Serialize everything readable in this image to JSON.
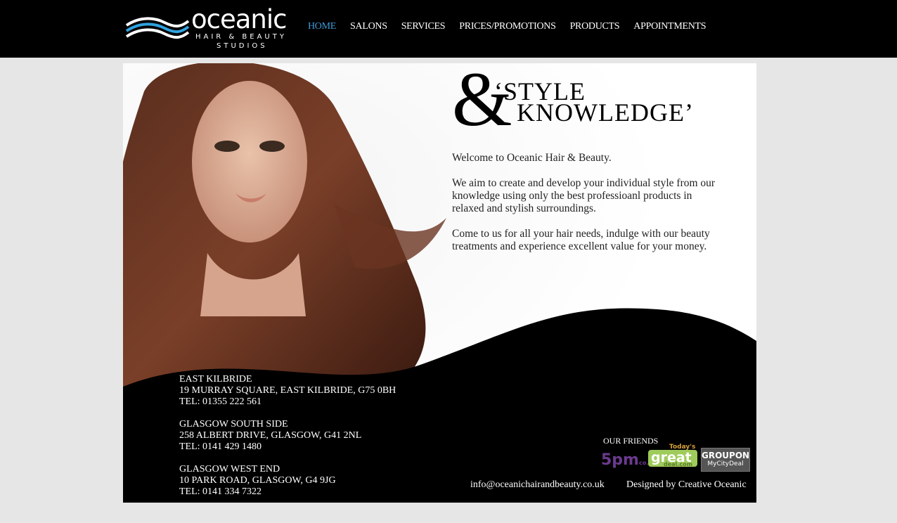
{
  "logo": {
    "word": "oceanic",
    "line1": "HAIR & BEAUTY",
    "line2": "STUDIOS"
  },
  "nav": [
    {
      "label": "HOME",
      "active": true
    },
    {
      "label": "SALONS"
    },
    {
      "label": "SERVICES"
    },
    {
      "label": "PRICES/PROMOTIONS"
    },
    {
      "label": "PRODUCTS"
    },
    {
      "label": "APPOINTMENTS"
    }
  ],
  "headline": {
    "amp": "&",
    "line1": "‘STYLE",
    "line2": "KNOWLEDGE’"
  },
  "copy": [
    "Welcome to Oceanic Hair & Beauty.",
    "We aim to create and develop your individual style from our knowledge using only the best professioanl products in relaxed and stylish surroundings.",
    "Come to us for all your hair needs, indulge with our beauty treatments and experience excellent value for your money."
  ],
  "addresses": [
    {
      "name": "EAST KILBRIDE",
      "street": "19 MURRAY SQUARE, EAST KILBRIDE, G75 0BH",
      "tel": "TEL: 01355 222 561"
    },
    {
      "name": "GLASGOW SOUTH SIDE",
      "street": "258 ALBERT DRIVE, GLASGOW, G41 2NL",
      "tel": "TEL: 0141 429 1480"
    },
    {
      "name": "GLASGOW WEST END",
      "street": "10 PARK ROAD, GLASGOW, G4 9JG",
      "tel": "TEL: 0141 334 7322"
    }
  ],
  "friends": {
    "label": "OUR FRIENDS",
    "partners": {
      "fivepm": "5pm",
      "fivepm_suffix": "co.uk",
      "great": "great",
      "great_top": "Today's",
      "great_bottom": "deal.com",
      "groupon": "GROUPON",
      "groupon_sub": "MyCityDeal"
    }
  },
  "footer": {
    "email": "info@oceanichairandbeauty.co.uk",
    "designed": "Designed by Creative Oceanic"
  },
  "colors": {
    "nav_active": "#3f9ad6",
    "logo_wave_blue": "#2fa3e0",
    "fivepm_purple": "#6b3a8e"
  }
}
